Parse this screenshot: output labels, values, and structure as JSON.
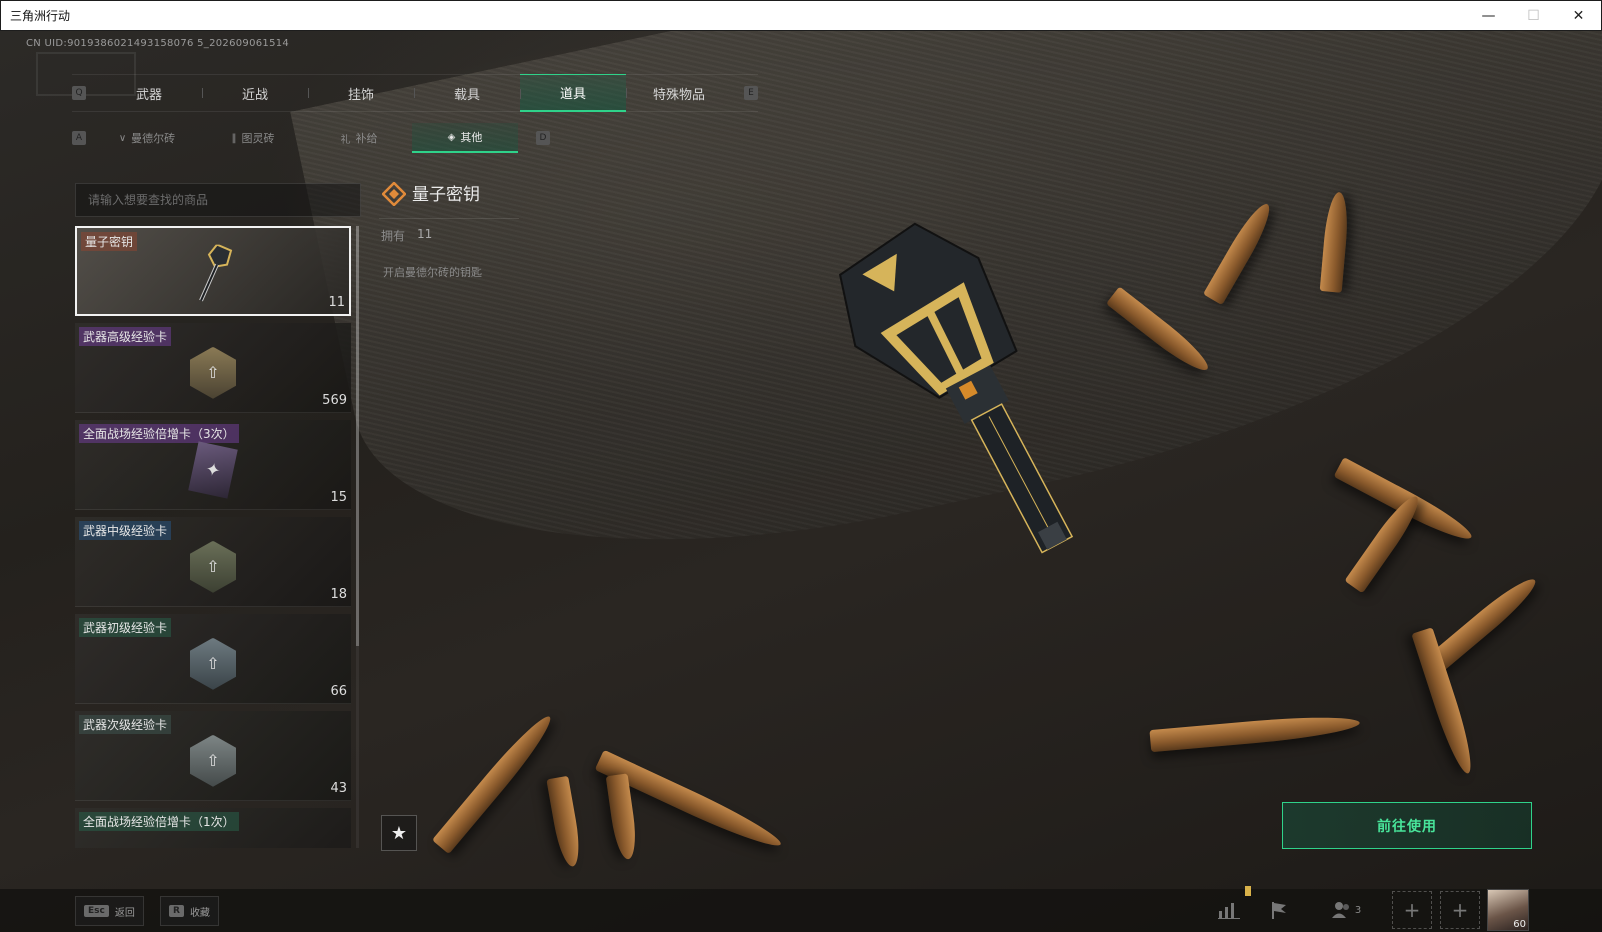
{
  "window": {
    "title": "三角洲行动",
    "minimize": "—",
    "maximize": "☐",
    "close": "✕"
  },
  "uid": "CN UID:9019386021493158076 5_202609061514",
  "top_tabs": {
    "left_key": "Q",
    "right_key": "E",
    "items": [
      {
        "label": "武器",
        "active": false
      },
      {
        "label": "近战",
        "active": false
      },
      {
        "label": "挂饰",
        "active": false
      },
      {
        "label": "载具",
        "active": false
      },
      {
        "label": "道具",
        "active": true
      },
      {
        "label": "特殊物品",
        "active": false
      }
    ]
  },
  "sub_tabs": {
    "left_key": "A",
    "right_key": "D",
    "items": [
      {
        "icon": "∨",
        "label": "曼德尔砖",
        "active": false
      },
      {
        "icon": "‖",
        "label": "图灵砖",
        "active": false
      },
      {
        "icon": "礼",
        "label": "补给",
        "active": false
      },
      {
        "icon": "◈",
        "label": "其他",
        "active": true
      }
    ]
  },
  "search": {
    "placeholder": "请输入想要查找的商品",
    "value": ""
  },
  "items": [
    {
      "name": "量子密钥",
      "count": "11",
      "selected": true,
      "color": "brown",
      "icon": "key-icon"
    },
    {
      "name": "武器高级经验卡",
      "count": "569",
      "selected": false,
      "color": "purple",
      "icon": "hex-gold-icon"
    },
    {
      "name": "全面战场经验倍增卡（3次）",
      "count": "15",
      "selected": false,
      "color": "purple",
      "icon": "card-icon"
    },
    {
      "name": "武器中级经验卡",
      "count": "18",
      "selected": false,
      "color": "blue",
      "icon": "hex-olive-icon"
    },
    {
      "name": "武器初级经验卡",
      "count": "66",
      "selected": false,
      "color": "green",
      "icon": "hex-steel-icon"
    },
    {
      "name": "武器次级经验卡",
      "count": "43",
      "selected": false,
      "color": "gray",
      "icon": "hex-slate-icon"
    },
    {
      "name": "全面战场经验倍增卡（1次）",
      "count": "",
      "selected": false,
      "color": "green",
      "icon": "card-icon"
    }
  ],
  "detail": {
    "name": "量子密钥",
    "owned_label": "拥有",
    "owned_value": "11",
    "description": "开启曼德尔砖的钥匙"
  },
  "favorite_icon": "★",
  "use_button": "前往使用",
  "bottom": {
    "back": {
      "key": "Esc",
      "label": "返回"
    },
    "collect": {
      "key": "R",
      "label": "收藏"
    },
    "party_count": "3",
    "avatar_level": "60"
  },
  "colors": {
    "accent": "#2fd28a",
    "accent_text": "#48e49a"
  }
}
